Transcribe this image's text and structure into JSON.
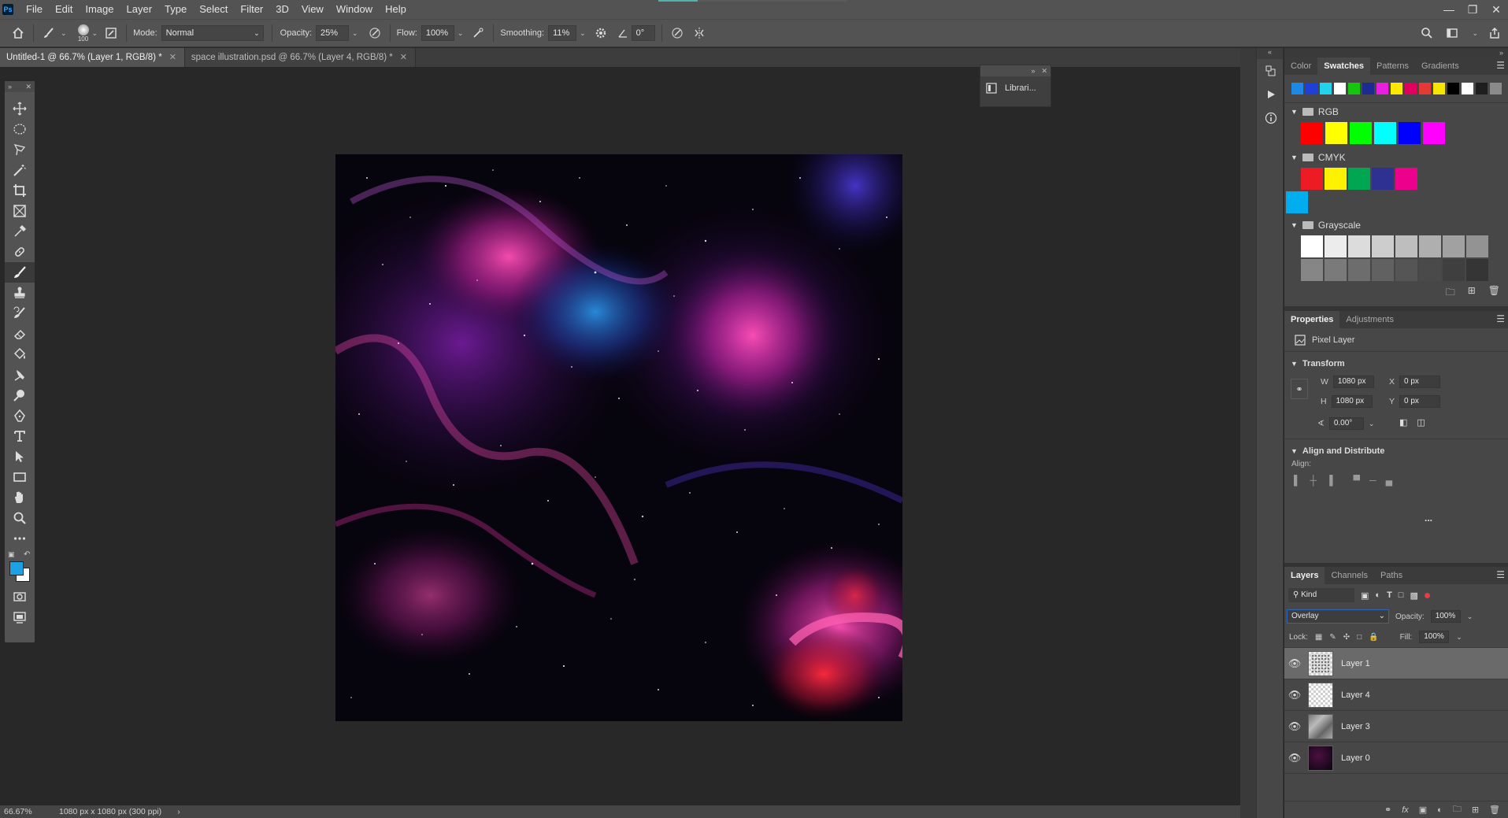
{
  "app": {
    "logo": "Ps",
    "menu": [
      "File",
      "Edit",
      "Image",
      "Layer",
      "Type",
      "Select",
      "Filter",
      "3D",
      "View",
      "Window",
      "Help"
    ]
  },
  "options": {
    "brush_size": "100",
    "mode_label": "Mode:",
    "mode_value": "Normal",
    "opacity_label": "Opacity:",
    "opacity_value": "25%",
    "flow_label": "Flow:",
    "flow_value": "100%",
    "smoothing_label": "Smoothing:",
    "smoothing_value": "11%",
    "angle_value": "0°"
  },
  "tabs": [
    {
      "label": "Untitled-1 @ 66.7% (Layer 1, RGB/8) *",
      "active": true
    },
    {
      "label": "space illustration.psd @ 66.7% (Layer 4, RGB/8) *",
      "active": false
    }
  ],
  "colors": {
    "foreground": "#1da1e4",
    "background": "#ffffff"
  },
  "libraries": {
    "label": "Librari..."
  },
  "status": {
    "zoom": "66.67%",
    "doc_info": "1080 px x 1080 px (300 ppi)",
    "arrow": "›"
  },
  "swatches_panel": {
    "tabs": [
      "Color",
      "Swatches",
      "Patterns",
      "Gradients"
    ],
    "active_tab": "Swatches",
    "recent": [
      "#1e88e5",
      "#1f3fd6",
      "#22d3ee",
      "#ffffff",
      "#16c60c",
      "#1c2b8f",
      "#e81ee0",
      "#fde800",
      "#e2005e",
      "#e53935",
      "#f7e600",
      "#000000",
      "#ffffff",
      "#1e1e1e",
      "#8a8a8a"
    ],
    "groups": [
      {
        "name": "RGB",
        "colors": [
          "#ff0000",
          "#ffff00",
          "#00ff00",
          "#00ffff",
          "#0000ff",
          "#ff00ff"
        ]
      },
      {
        "name": "CMYK",
        "colors": [
          "#ed1c24",
          "#fff200",
          "#00a651",
          "#2e3192",
          "#ec008c",
          "#00aeef"
        ]
      },
      {
        "name": "Grayscale",
        "colors": [
          "#ffffff",
          "#ececec",
          "#dcdcdc",
          "#cdcdcd",
          "#bebebe",
          "#afafaf",
          "#a1a1a1",
          "#939393",
          "#868686",
          "#7a7a7a",
          "#6d6d6d",
          "#616161",
          "#555555",
          "#4a4a4a",
          "#3f3f3f",
          "#353535"
        ]
      }
    ]
  },
  "properties_panel": {
    "tabs": [
      "Properties",
      "Adjustments"
    ],
    "active_tab": "Properties",
    "kind": "Pixel Layer",
    "transform_title": "Transform",
    "w_label": "W",
    "w_value": "1080 px",
    "h_label": "H",
    "h_value": "1080 px",
    "x_label": "X",
    "x_value": "0 px",
    "y_label": "Y",
    "y_value": "0 px",
    "angle_value": "0.00°",
    "align_title": "Align and Distribute",
    "align_label": "Align:",
    "more": "..."
  },
  "layers_panel": {
    "tabs": [
      "Layers",
      "Channels",
      "Paths"
    ],
    "active_tab": "Layers",
    "filter_kind": "Kind",
    "blend_mode": "Overlay",
    "opacity_label": "Opacity:",
    "opacity_value": "100%",
    "lock_label": "Lock:",
    "fill_label": "Fill:",
    "fill_value": "100%",
    "layers": [
      {
        "name": "Layer 1",
        "selected": true
      },
      {
        "name": "Layer 4",
        "selected": false
      },
      {
        "name": "Layer 3",
        "selected": false
      },
      {
        "name": "Layer 0",
        "selected": false
      }
    ]
  }
}
